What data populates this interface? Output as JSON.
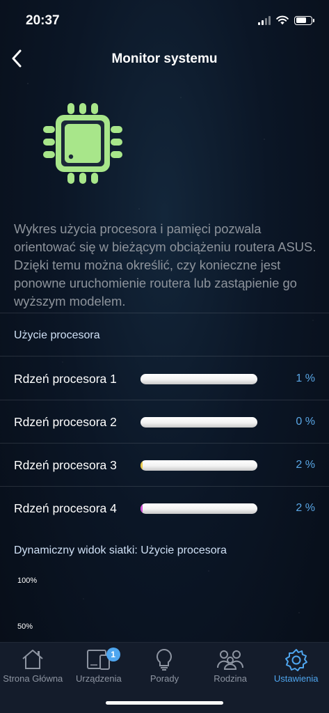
{
  "status_bar": {
    "time": "20:37"
  },
  "header": {
    "title": "Monitor systemu"
  },
  "description": "Wykres użycia procesora i pamięci pozwala orientować się w bieżącym obciążeniu routera ASUS. Dzięki temu można określić, czy konieczne jest ponowne uruchomienie routera lub zastąpienie go wyższym modelem.",
  "cpu_section": {
    "title": "Użycie procesora",
    "cores": [
      {
        "label": "Rdzeń procesora 1",
        "value_text": "1 %",
        "value": 1,
        "fill_color": "#f1f1f1"
      },
      {
        "label": "Rdzeń procesora 2",
        "value_text": "0 %",
        "value": 0,
        "fill_color": "#f1f1f1"
      },
      {
        "label": "Rdzeń procesora 3",
        "value_text": "2 %",
        "value": 2,
        "fill_color": "#e8c84a"
      },
      {
        "label": "Rdzeń procesora 4",
        "value_text": "2 %",
        "value": 2,
        "fill_color": "#d24fd8"
      }
    ]
  },
  "dynamic_chart": {
    "title": "Dynamiczny widok siatki: Użycie procesora",
    "ticks": [
      "100%",
      "50%"
    ]
  },
  "tab_bar": {
    "tabs": [
      {
        "label": "Strona Główna",
        "icon": "home-icon",
        "active": false
      },
      {
        "label": "Urządzenia",
        "icon": "devices-icon",
        "active": false,
        "badge": "1"
      },
      {
        "label": "Porady",
        "icon": "lightbulb-icon",
        "active": false
      },
      {
        "label": "Rodzina",
        "icon": "family-icon",
        "active": false
      },
      {
        "label": "Ustawienia",
        "icon": "gear-icon",
        "active": true
      }
    ]
  },
  "colors": {
    "accent": "#4fa6ef",
    "chip": "#a8e68a",
    "value_text": "#5aa7e6",
    "section_header": "#cfe0f5"
  }
}
